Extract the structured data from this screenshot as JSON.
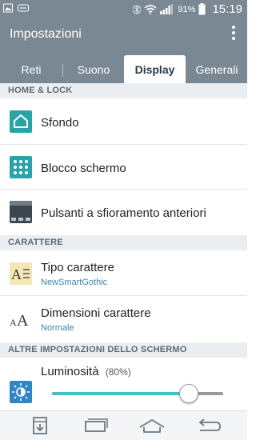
{
  "status_bar": {
    "battery_percent": "91%",
    "time": "15:19",
    "icons": [
      "image-icon",
      "message-icon",
      "bluetooth-icon",
      "wifi-icon",
      "signal-icon",
      "battery-icon"
    ]
  },
  "app_bar": {
    "title": "Impostazioni",
    "menu_icon": "overflow-menu-icon"
  },
  "tabs": [
    {
      "label": "Reti",
      "active": false
    },
    {
      "label": "Suono",
      "active": false
    },
    {
      "label": "Display",
      "active": true
    },
    {
      "label": "Generali",
      "active": false
    }
  ],
  "sections": {
    "home_lock": "HOME & LOCK",
    "carattere": "CARATTERE",
    "altre": "ALTRE IMPOSTAZIONI DELLO SCHERMO"
  },
  "items": {
    "sfondo": {
      "label": "Sfondo",
      "icon": "home-icon"
    },
    "blocco": {
      "label": "Blocco schermo",
      "icon": "pattern-lock-icon"
    },
    "pulsanti": {
      "label": "Pulsanti a sfioramento anteriori",
      "icon": "front-touch-buttons-icon"
    },
    "tipo": {
      "label": "Tipo carattere",
      "value": "NewSmartGothic",
      "icon": "font-type-icon"
    },
    "dimensioni": {
      "label": "Dimensioni carattere",
      "value": "Normale",
      "icon": "font-size-icon"
    },
    "luminosita": {
      "label": "Luminosità",
      "value": "(80%)",
      "level_percent": 80,
      "icon": "brightness-icon"
    }
  },
  "nav_bar": [
    "save-screen-icon",
    "recent-apps-icon",
    "home-icon",
    "back-icon"
  ],
  "colors": {
    "bar": "#7a8894",
    "accent": "#43c0c2",
    "section_bg": "#ebeef0",
    "subtext": "#3a86a6"
  }
}
